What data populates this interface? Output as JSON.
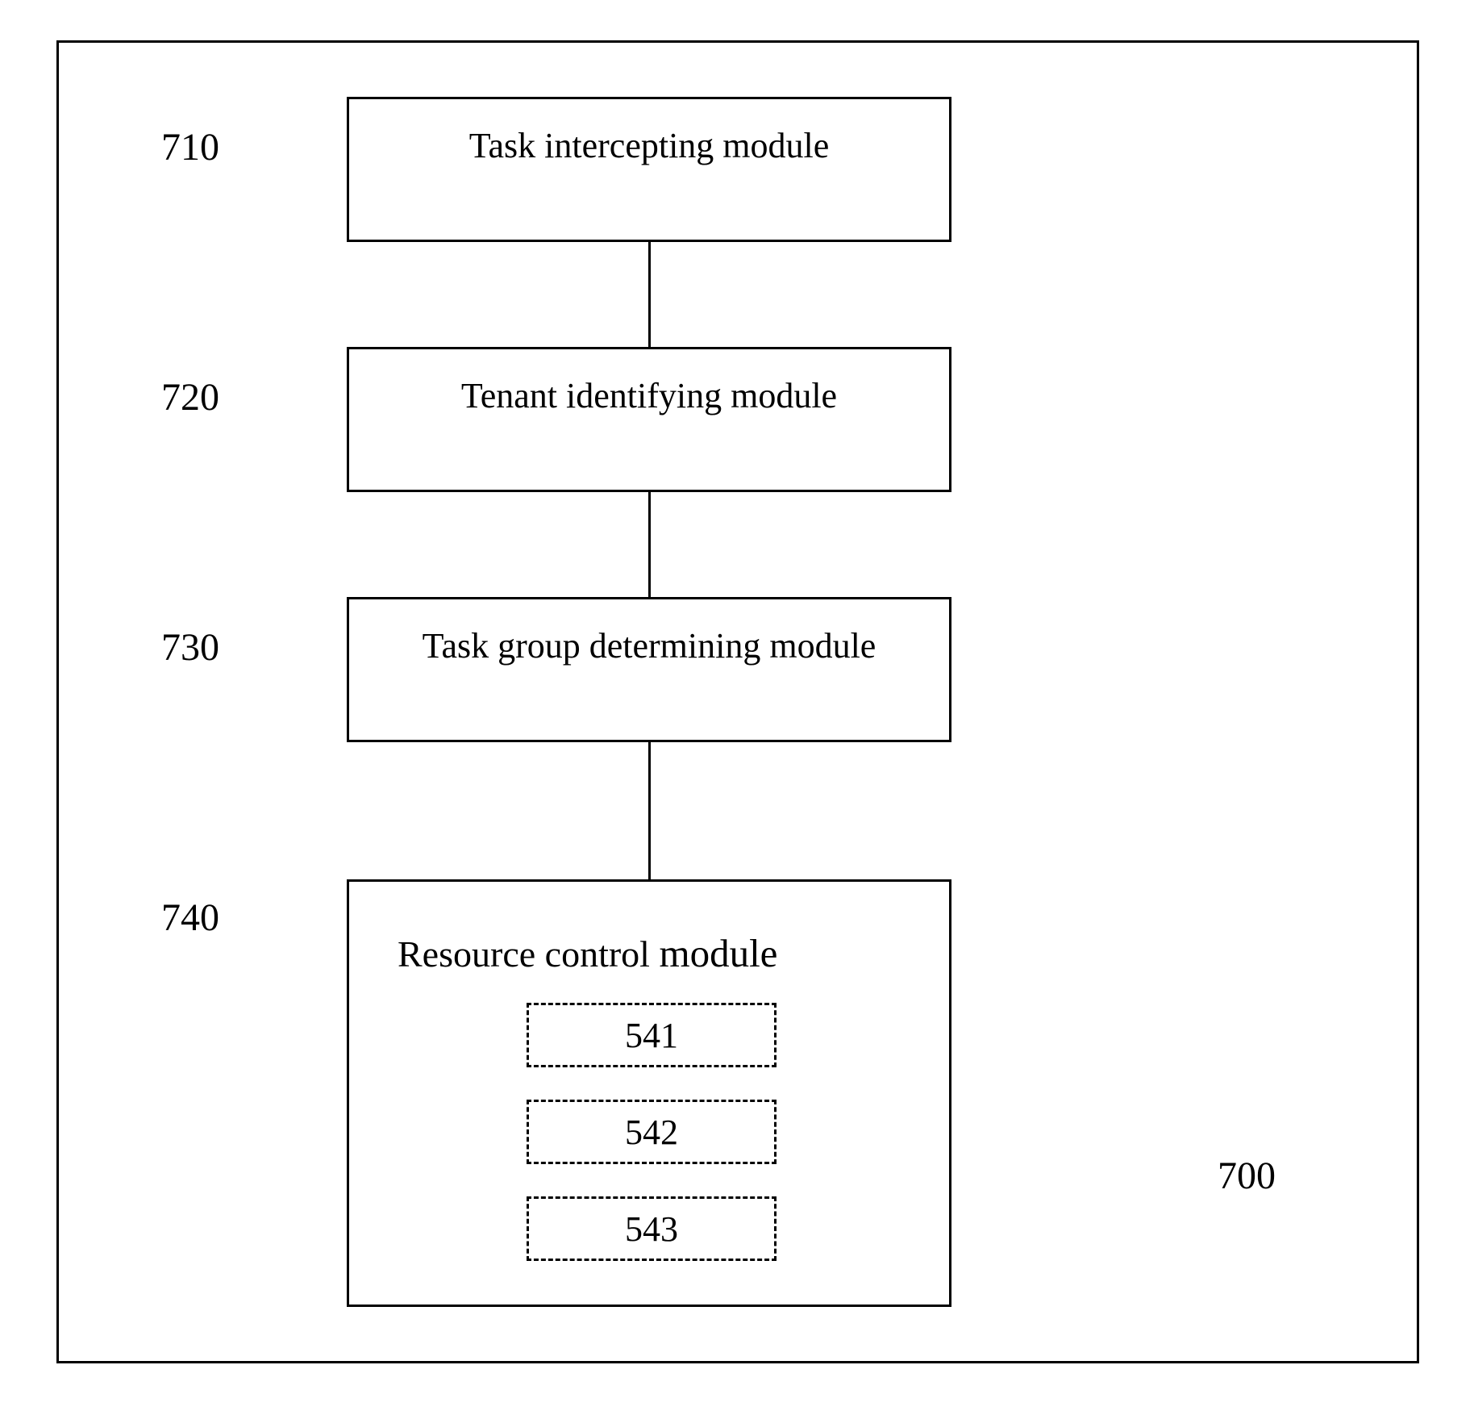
{
  "labels": {
    "ref_710": "710",
    "ref_720": "720",
    "ref_730": "730",
    "ref_740": "740",
    "ref_700": "700"
  },
  "modules": {
    "task_intercepting": "Task intercepting module",
    "tenant_identifying": "Tenant identifying module",
    "task_group_determining": "Task group determining module",
    "resource_control_prefix": "Resource control ",
    "resource_control_module_word": "module"
  },
  "sub_modules": {
    "s541": "541",
    "s542": "542",
    "s543": "543"
  }
}
